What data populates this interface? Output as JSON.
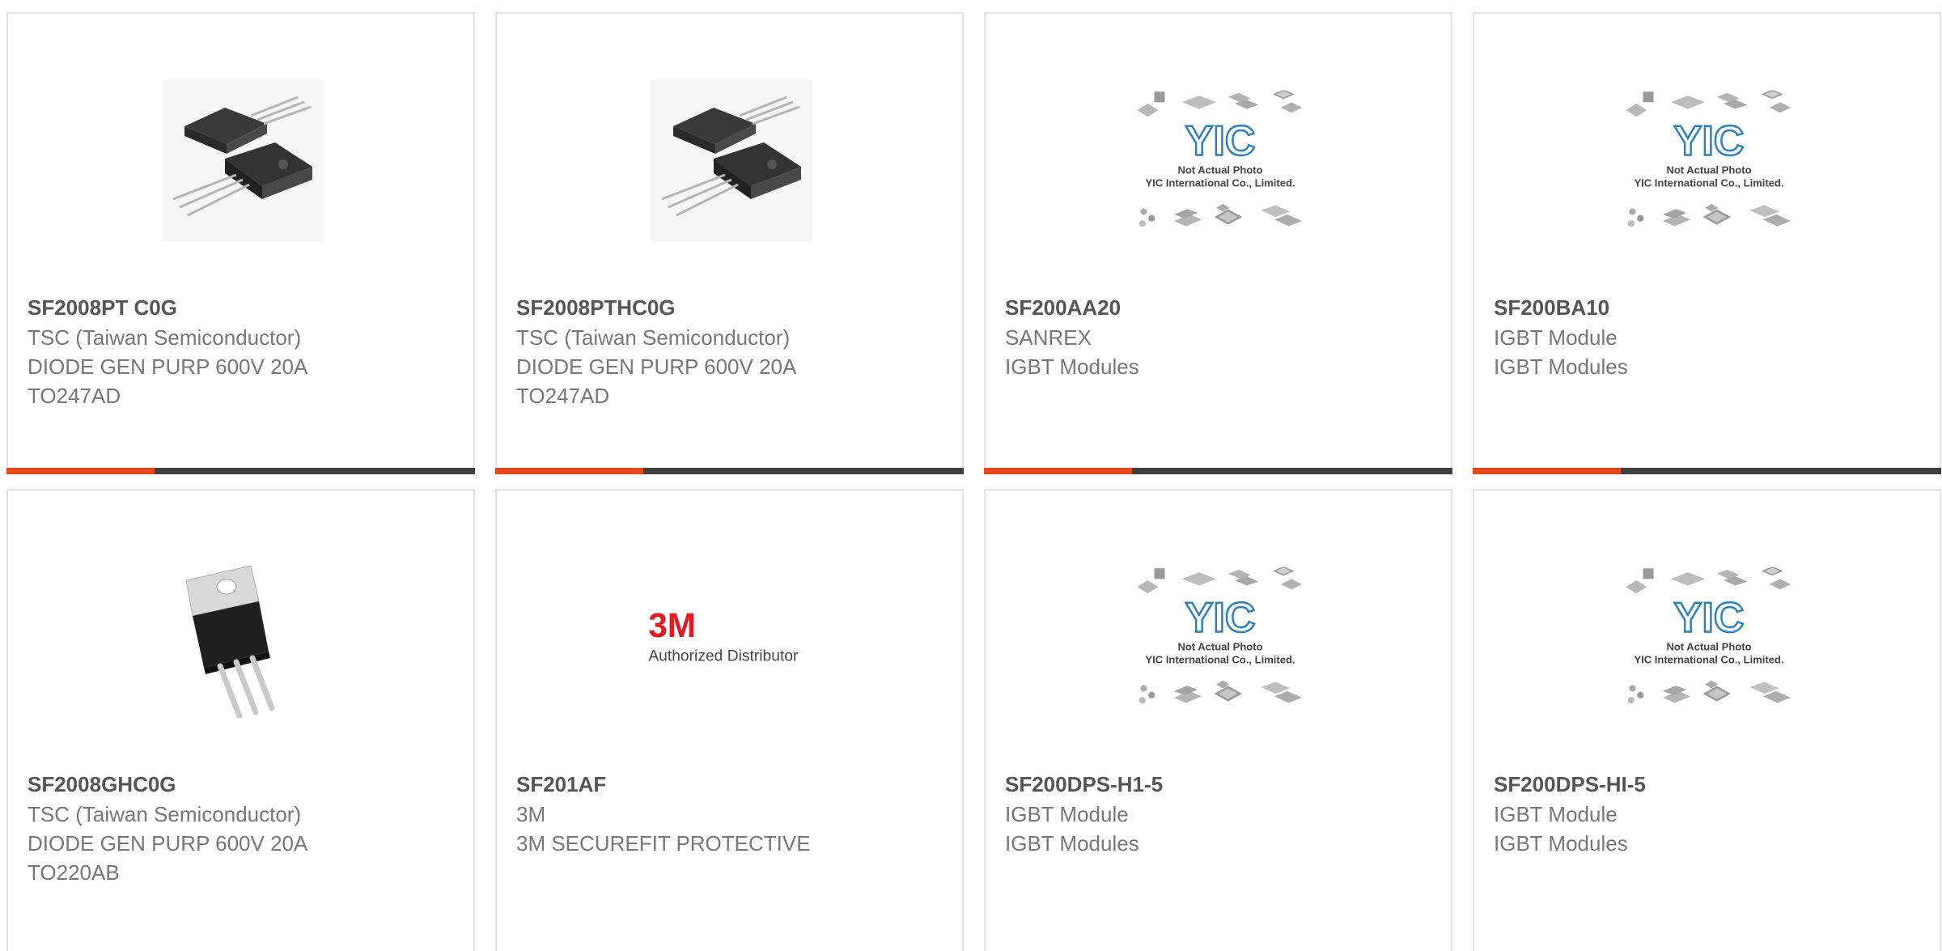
{
  "products": [
    {
      "part_number": "SF2008PT C0G",
      "manufacturer": "TSC (Taiwan Semiconductor)",
      "description": "DIODE GEN PURP 600V 20A",
      "package": "TO247AD",
      "image": "to247-diode-photo"
    },
    {
      "part_number": "SF2008PTHC0G",
      "manufacturer": "TSC (Taiwan Semiconductor)",
      "description": "DIODE GEN PURP 600V 20A",
      "package": "TO247AD",
      "image": "to247-diode-photo"
    },
    {
      "part_number": "SF200AA20",
      "manufacturer": "SANREX",
      "description": "IGBT Modules",
      "package": "",
      "image": "yic-placeholder",
      "placeholder_line1": "Not Actual Photo",
      "placeholder_line2": "YIC International Co., Limited.",
      "placeholder_logo": "YIC"
    },
    {
      "part_number": "SF200BA10",
      "manufacturer": "IGBT Module",
      "description": "IGBT Modules",
      "package": "",
      "image": "yic-placeholder",
      "placeholder_line1": "Not Actual Photo",
      "placeholder_line2": "YIC International Co., Limited.",
      "placeholder_logo": "YIC"
    },
    {
      "part_number": "SF2008GHC0G",
      "manufacturer": "TSC (Taiwan Semiconductor)",
      "description": "DIODE GEN PURP 600V 20A",
      "package": "TO220AB",
      "image": "to220-diode-photo"
    },
    {
      "part_number": "SF201AF",
      "manufacturer": "3M",
      "description": "3M SECUREFIT PROTECTIVE",
      "package": "",
      "image": "3m-logo",
      "logo_text": "3M",
      "logo_caption": "Authorized Distributor"
    },
    {
      "part_number": "SF200DPS-H1-5",
      "manufacturer": "IGBT Module",
      "description": "IGBT Modules",
      "package": "",
      "image": "yic-placeholder",
      "placeholder_line1": "Not Actual Photo",
      "placeholder_line2": "YIC International Co., Limited.",
      "placeholder_logo": "YIC"
    },
    {
      "part_number": "SF200DPS-HI-5",
      "manufacturer": "IGBT Module",
      "description": "IGBT Modules",
      "package": "",
      "image": "yic-placeholder",
      "placeholder_line1": "Not Actual Photo",
      "placeholder_line2": "YIC International Co., Limited.",
      "placeholder_logo": "YIC"
    }
  ],
  "colors": {
    "accent_bar": "#e8461e",
    "dark_bar": "#404040",
    "card_border": "#e3e3e3",
    "part_number_text": "#555555",
    "secondary_text": "#777777",
    "yic_logo_blue": "#2a7fc1",
    "brand_3m_red": "#e21b23"
  }
}
